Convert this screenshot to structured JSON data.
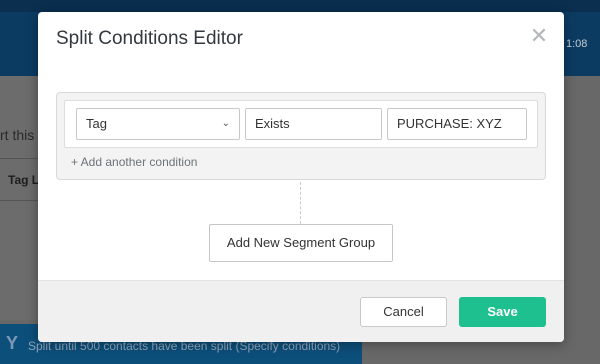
{
  "background": {
    "time_text": "1:08",
    "partial_text_1": "rt this",
    "partial_text_2": "Tag L",
    "footer_text": "Split until 500 contacts have been split (Specify conditions)",
    "footer_icon": "split-icon"
  },
  "modal": {
    "title": "Split Conditions Editor",
    "close_icon": "close-icon",
    "condition": {
      "field": "Tag",
      "operator": "Exists",
      "value": "PURCHASE: XYZ"
    },
    "add_condition_label": "+ Add another condition",
    "add_segment_label": "Add New Segment Group",
    "cancel_label": "Cancel",
    "save_label": "Save"
  },
  "colors": {
    "save_button": "#1ec08f",
    "header": "#0c3b62"
  }
}
